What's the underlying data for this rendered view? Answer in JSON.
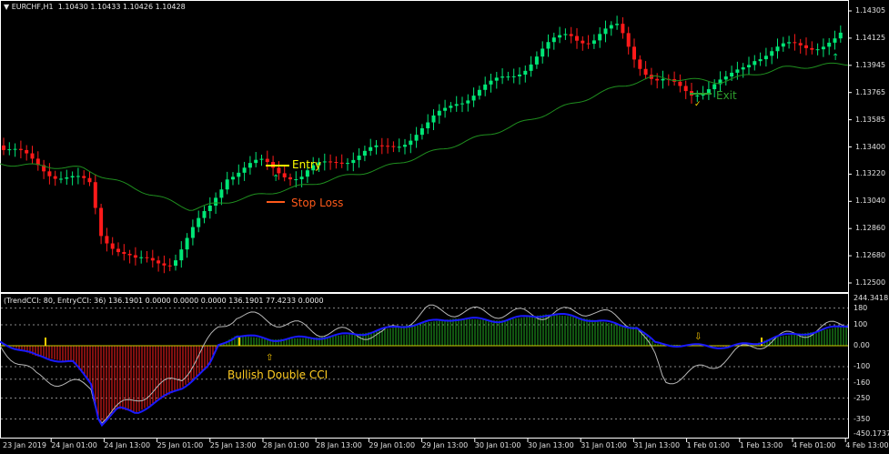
{
  "header": {
    "symbol": "EURCHF,H1",
    "ohlc": "1.10430 1.10433 1.10426 1.10428"
  },
  "indicator_header": "(TrendCCI: 80, EntryCCI: 36)  136.1901 0.0000 0.0000 0.0000 136.1901 77.4233 0.0000",
  "annotations": {
    "entry": "Entry",
    "stop_loss": "Stop Loss",
    "exit": "Exit",
    "signal": "Bullish Double CCI"
  },
  "colors": {
    "bull": "#00e676",
    "bear": "#ff1a1a",
    "ma": "#1f8f1f",
    "entry": "#ffff00",
    "stop": "#ff5a1a",
    "exit": "#2e9e2e",
    "cci_entry": "#1a1aff",
    "cci_trend": "#b8b8b8",
    "signal_marker": "#ffcc00",
    "signal_text": "#ffcc22"
  },
  "price_axis": [
    "1.14305",
    "1.14125",
    "1.13945",
    "1.13765",
    "1.13585",
    "1.13400",
    "1.13220",
    "1.13040",
    "1.12860",
    "1.12680",
    "1.12500"
  ],
  "indicator_axis": [
    "244.3418",
    "180",
    "100",
    "0.00",
    "-100",
    "-160",
    "-250",
    "-350",
    "-450.1737"
  ],
  "time_axis": [
    "23 Jan 2019",
    "24 Jan 01:00",
    "24 Jan 13:00",
    "25 Jan 01:00",
    "25 Jan 13:00",
    "28 Jan 01:00",
    "28 Jan 13:00",
    "29 Jan 01:00",
    "29 Jan 13:00",
    "30 Jan 01:00",
    "30 Jan 13:00",
    "31 Jan 01:00",
    "31 Jan 13:00",
    "1 Feb 01:00",
    "1 Feb 13:00",
    "4 Feb 01:00",
    "4 Feb 13:00"
  ],
  "chart_data": {
    "type": "candlestick",
    "price_range": [
      1.125,
      1.14305
    ],
    "close_path": [
      [
        0,
        1.13412
      ],
      [
        60,
        1.1323
      ],
      [
        100,
        1.1314
      ],
      [
        110,
        1.12838
      ],
      [
        150,
        1.12627
      ],
      [
        190,
        1.12657
      ],
      [
        230,
        1.12989
      ],
      [
        250,
        1.1323
      ],
      [
        290,
        1.13291
      ],
      [
        330,
        1.132
      ],
      [
        370,
        1.13321
      ],
      [
        420,
        1.13381
      ],
      [
        470,
        1.13532
      ],
      [
        500,
        1.13713
      ],
      [
        540,
        1.13804
      ],
      [
        580,
        1.13955
      ],
      [
        625,
        1.14166
      ],
      [
        650,
        1.14106
      ],
      [
        680,
        1.14196
      ],
      [
        700,
        1.13985
      ],
      [
        720,
        1.13834
      ],
      [
        760,
        1.13774
      ],
      [
        800,
        1.13834
      ],
      [
        830,
        1.14015
      ],
      [
        880,
        1.14075
      ],
      [
        920,
        1.14106
      ],
      [
        932,
        1.14166
      ]
    ],
    "ma_path": [
      [
        0,
        1.13291
      ],
      [
        90,
        1.13261
      ],
      [
        210,
        1.12989
      ],
      [
        330,
        1.1314
      ],
      [
        420,
        1.13261
      ],
      [
        560,
        1.13532
      ],
      [
        680,
        1.13804
      ],
      [
        720,
        1.13864
      ],
      [
        790,
        1.13834
      ],
      [
        860,
        1.13925
      ],
      [
        932,
        1.13955
      ]
    ],
    "cci_range": [
      -450.1737,
      244.3418
    ],
    "entry_cci": [
      [
        0,
        20
      ],
      [
        40,
        -50
      ],
      [
        80,
        -80
      ],
      [
        100,
        -180
      ],
      [
        110,
        -380
      ],
      [
        130,
        -300
      ],
      [
        150,
        -320
      ],
      [
        200,
        -200
      ],
      [
        230,
        -100
      ],
      [
        240,
        0
      ],
      [
        260,
        50
      ],
      [
        300,
        30
      ],
      [
        350,
        40
      ],
      [
        400,
        60
      ],
      [
        450,
        100
      ],
      [
        500,
        130
      ],
      [
        550,
        120
      ],
      [
        600,
        150
      ],
      [
        630,
        140
      ],
      [
        680,
        100
      ],
      [
        700,
        90
      ],
      [
        720,
        10
      ],
      [
        760,
        0
      ],
      [
        800,
        -5
      ],
      [
        830,
        10
      ],
      [
        850,
        40
      ],
      [
        900,
        70
      ],
      [
        932,
        100
      ]
    ],
    "trend_cci": [
      [
        0,
        0
      ],
      [
        40,
        -150
      ],
      [
        100,
        -200
      ],
      [
        110,
        -350
      ],
      [
        150,
        -250
      ],
      [
        200,
        -150
      ],
      [
        240,
        80
      ],
      [
        260,
        150
      ],
      [
        300,
        120
      ],
      [
        350,
        70
      ],
      [
        420,
        50
      ],
      [
        470,
        170
      ],
      [
        520,
        160
      ],
      [
        600,
        150
      ],
      [
        650,
        170
      ],
      [
        700,
        100
      ],
      [
        720,
        -60
      ],
      [
        730,
        -170
      ],
      [
        780,
        -100
      ],
      [
        810,
        -30
      ],
      [
        850,
        30
      ],
      [
        932,
        110
      ]
    ],
    "levels": [
      180,
      100,
      0,
      -100,
      -160,
      -250,
      -350
    ]
  }
}
